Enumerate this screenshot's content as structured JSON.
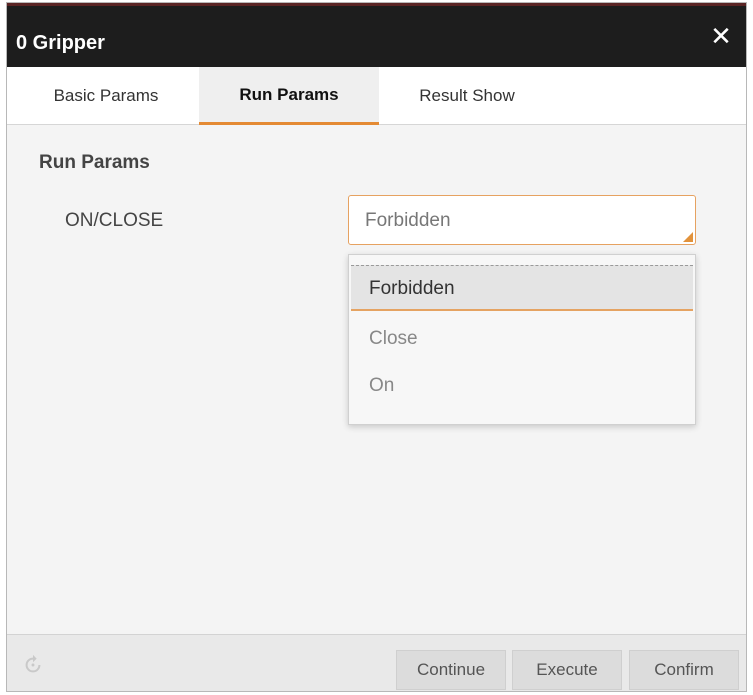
{
  "dialog": {
    "title": "0 Gripper",
    "close_glyph": "✕"
  },
  "tabs": [
    {
      "label": "Basic Params",
      "active": false
    },
    {
      "label": "Run Params",
      "active": true
    },
    {
      "label": "Result Show",
      "active": false
    }
  ],
  "content": {
    "section_title": "Run Params",
    "field_label": "ON/CLOSE",
    "select_value": "Forbidden",
    "options": [
      {
        "label": "Forbidden",
        "selected": true
      },
      {
        "label": "Close",
        "selected": false
      },
      {
        "label": "On",
        "selected": false
      }
    ]
  },
  "footer": {
    "refresh_icon": "refresh-icon",
    "buttons": {
      "continue": "Continue",
      "execute": "Execute",
      "confirm": "Confirm"
    }
  },
  "colors": {
    "accent": "#e48a33",
    "titlebar": "#1d1d1d"
  }
}
